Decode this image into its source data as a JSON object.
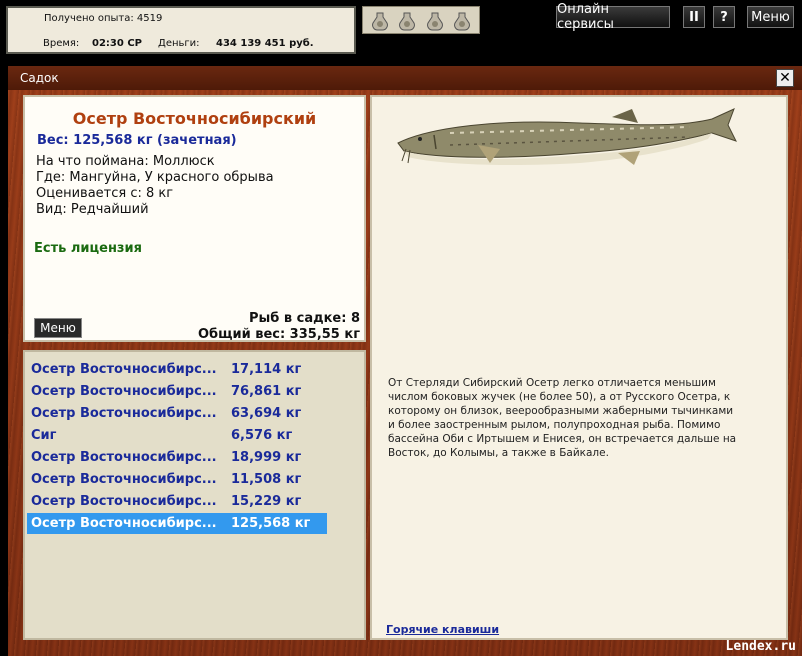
{
  "topbar": {
    "experience": "Получено опыта: 4519",
    "time_label": "Время:",
    "time_value": "02:30 СР",
    "money_label": "Деньги:",
    "money_value": "434 139 451 руб.",
    "bait_slots": [
      "bait-jar-icon",
      "bait-jar-icon",
      "bait-jar-icon",
      "bait-jar-icon"
    ],
    "online_services": "Онлайн сервисы",
    "pause": "II",
    "help": "?",
    "menu": "Меню"
  },
  "window": {
    "title": "Садок",
    "close": "✕"
  },
  "fish": {
    "name": "Осетр Восточносибирский",
    "weight": "Вес: 125,568 кг (зачетная)",
    "caught_on": "На что поймана: Моллюск",
    "where": "Где: Мангуйна, У красного обрыва",
    "valued_from": "Оценивается с: 8 кг",
    "kind": "Вид: Редчайший",
    "license": "Есть лицензия",
    "menu_button": "Меню",
    "fish_in_keeper": "Рыб в садке: 8",
    "total_weight": "Общий вес: 335,55 кг"
  },
  "catch_list": [
    {
      "name": "Осетр Восточносибирс...",
      "weight": "17,114 кг"
    },
    {
      "name": "Осетр Восточносибирс...",
      "weight": "76,861 кг"
    },
    {
      "name": "Осетр Восточносибирс...",
      "weight": "63,694 кг"
    },
    {
      "name": "Сиг",
      "weight": "6,576 кг"
    },
    {
      "name": "Осетр Восточносибирс...",
      "weight": "18,999 кг"
    },
    {
      "name": "Осетр Восточносибирс...",
      "weight": "11,508 кг"
    },
    {
      "name": "Осетр Восточносибирс...",
      "weight": "15,229 кг"
    },
    {
      "name": "Осетр Восточносибирс...",
      "weight": "125,568 кг",
      "selected": true
    }
  ],
  "description": {
    "text": "От Стерляди Сибирский Осетр легко отличается меньшим числом боковых жучек (не более 50), а от Русского Осетра, к которому он близок, веерообразными жаберными тычинками и более заостренным рылом, полупроходная рыба. Помимо бассейна Оби с Иртышем и Енисея, он встречается дальше на Восток, до Колымы, а также в Байкале.",
    "hotkeys_link": "Горячие клавиши"
  },
  "watermark": "Lendex.ru",
  "colors": {
    "wood": "#8a3416",
    "fish_name": "#b04010",
    "link_blue": "#1a2a9a",
    "license_green": "#1a6a10",
    "selection": "#3399ee"
  }
}
